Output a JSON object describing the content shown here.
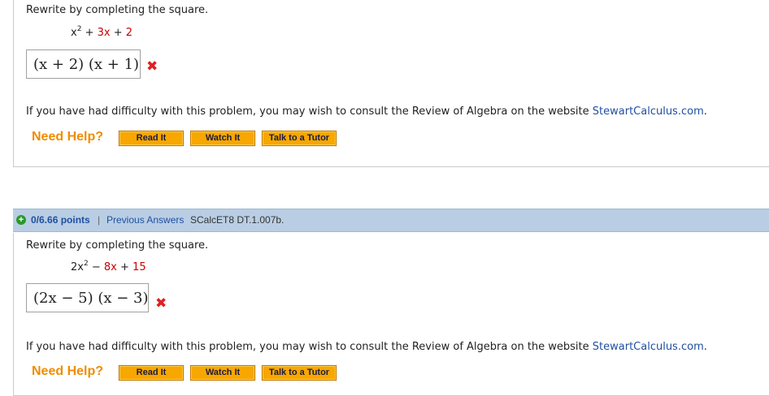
{
  "questions": [
    {
      "prompt": "Rewrite by completing the square.",
      "poly": {
        "t1": "x",
        "e1": "2",
        "op1": "+",
        "t2": "3x",
        "op2": "+",
        "t3": "2"
      },
      "answer": "(x + 2) (x + 1)",
      "help_text": "If you have had difficulty with this problem, you may wish to consult the Review of Algebra on the website ",
      "help_link": "StewartCalculus.com",
      "help_tail": ".",
      "need_help": "Need Help?",
      "buttons": {
        "read": "Read It",
        "watch": "Watch It",
        "tutor": "Talk to a Tutor"
      }
    },
    {
      "header": {
        "plus": "+",
        "points": "0/6.66 points",
        "separator": "|",
        "previous": "Previous Answers",
        "id": "SCalcET8 DT.1.007b."
      },
      "prompt": "Rewrite by completing the square.",
      "poly": {
        "t1": "2x",
        "e1": "2",
        "op1": "−",
        "t2": "8x",
        "op2": "+",
        "t3": "15"
      },
      "answer": "(2x − 5) (x − 3)",
      "help_text": "If you have had difficulty with this problem, you may wish to consult the Review of Algebra on the website ",
      "help_link": "StewartCalculus.com",
      "help_tail": ".",
      "need_help": "Need Help?",
      "buttons": {
        "read": "Read It",
        "watch": "Watch It",
        "tutor": "Talk to a Tutor"
      }
    }
  ],
  "colors": {
    "accent": "#f7a700",
    "link": "#1f4fa0",
    "error": "#dd2222",
    "header_bar": "#b9cee4"
  },
  "icons": {
    "wrong": "x-mark-icon",
    "expand": "plus-circle-icon"
  }
}
